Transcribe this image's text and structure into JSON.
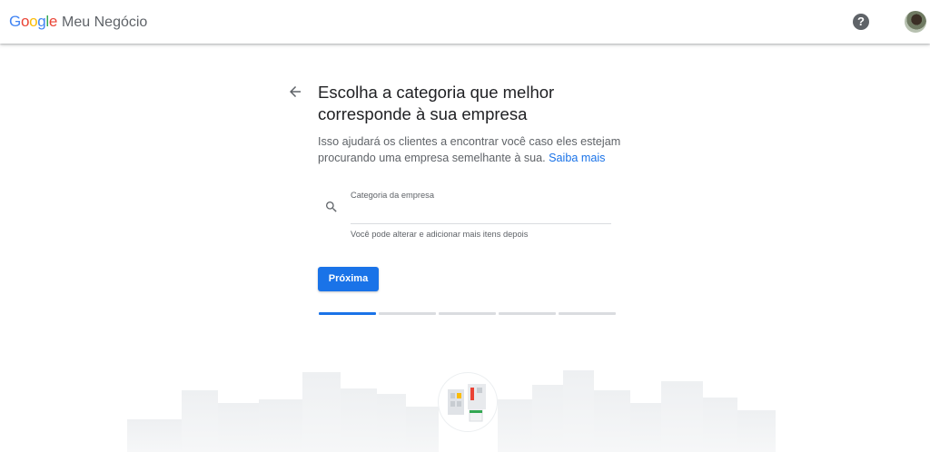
{
  "header": {
    "logo_text": "Google",
    "logo_letters": [
      {
        "ch": "G",
        "color": "#4285F4"
      },
      {
        "ch": "o",
        "color": "#EA4335"
      },
      {
        "ch": "o",
        "color": "#FBBC05"
      },
      {
        "ch": "g",
        "color": "#4285F4"
      },
      {
        "ch": "l",
        "color": "#34A853"
      },
      {
        "ch": "e",
        "color": "#EA4335"
      }
    ],
    "product_name": "Meu Negócio",
    "help_icon": "help-icon",
    "help_glyph": "?",
    "avatar_icon": "account-avatar"
  },
  "main": {
    "back_icon": "arrow-back-icon",
    "title": "Escolha a categoria que melhor corresponde à sua empresa",
    "description": "Isso ajudará os clientes a encontrar você caso eles estejam procurando uma empresa semelhante à sua.",
    "learn_more": "Saiba mais",
    "category_field": {
      "label": "Categoria da empresa",
      "value": "",
      "helper_text": "Você pode alterar e adicionar mais itens depois",
      "icon": "search-icon"
    },
    "next_button": "Próxima",
    "progress": {
      "total_steps": 5,
      "current_step": 1
    }
  },
  "colors": {
    "accent": "#1a73e8",
    "text_primary": "#202124",
    "text_secondary": "#5f6368",
    "divider": "#dadce0",
    "skyline": "#f1f3f4"
  }
}
